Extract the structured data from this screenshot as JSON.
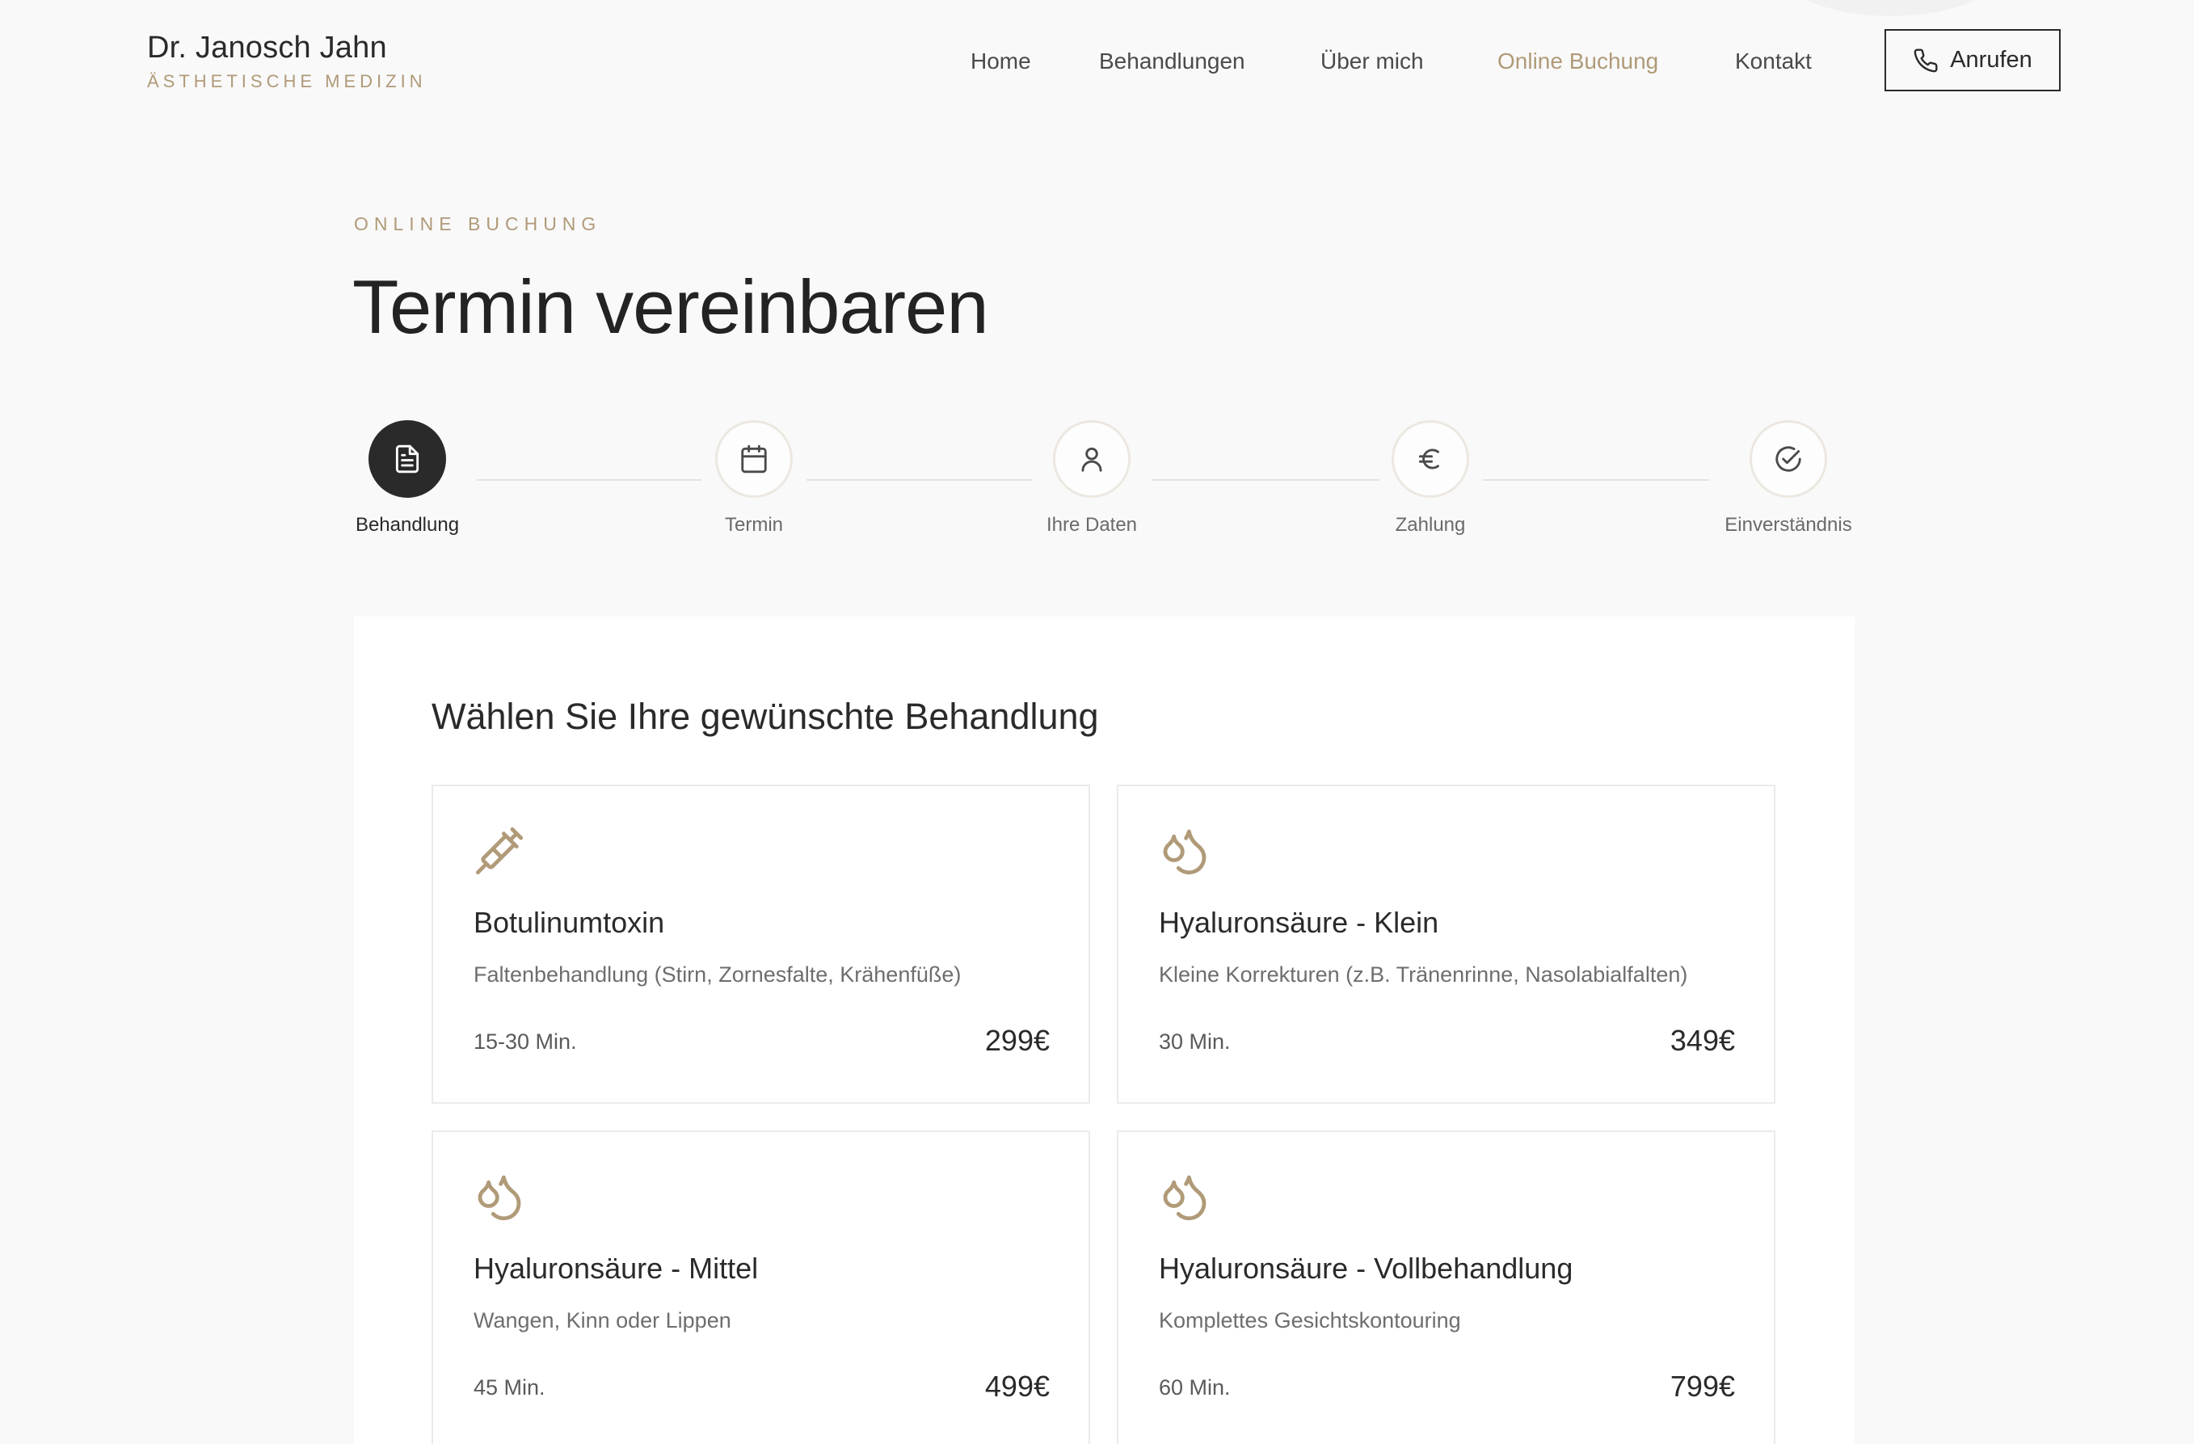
{
  "brand": {
    "name": "Dr. Janosch Jahn",
    "tagline": "ÄSTHETISCHE MEDIZIN"
  },
  "nav": {
    "items": [
      {
        "label": "Home",
        "active": false
      },
      {
        "label": "Behandlungen",
        "active": false
      },
      {
        "label": "Über mich",
        "active": false
      },
      {
        "label": "Online Buchung",
        "active": true
      },
      {
        "label": "Kontakt",
        "active": false
      }
    ],
    "call_label": "Anrufen"
  },
  "hero": {
    "eyebrow": "ONLINE BUCHUNG",
    "title": "Termin vereinbaren"
  },
  "steps": [
    {
      "label": "Behandlung",
      "icon": "document-icon",
      "active": true
    },
    {
      "label": "Termin",
      "icon": "calendar-icon",
      "active": false
    },
    {
      "label": "Ihre Daten",
      "icon": "user-icon",
      "active": false
    },
    {
      "label": "Zahlung",
      "icon": "euro-icon",
      "active": false
    },
    {
      "label": "Einverständnis",
      "icon": "check-circle-icon",
      "active": false
    }
  ],
  "treatments": {
    "heading": "Wählen Sie Ihre gewünschte Behandlung",
    "items": [
      {
        "name": "Botulinumtoxin",
        "description": "Faltenbehandlung (Stirn, Zornesfalte, Krähenfüße)",
        "duration": "15-30 Min.",
        "price": "299€",
        "icon": "syringe-icon"
      },
      {
        "name": "Hyaluronsäure - Klein",
        "description": "Kleine Korrekturen (z.B. Tränenrinne, Nasolabialfalten)",
        "duration": "30 Min.",
        "price": "349€",
        "icon": "droplets-icon"
      },
      {
        "name": "Hyaluronsäure - Mittel",
        "description": "Wangen, Kinn oder Lippen",
        "duration": "45 Min.",
        "price": "499€",
        "icon": "droplets-icon"
      },
      {
        "name": "Hyaluronsäure - Vollbehandlung",
        "description": "Komplettes Gesichtskontouring",
        "duration": "60 Min.",
        "price": "799€",
        "icon": "droplets-icon"
      }
    ]
  },
  "colors": {
    "accent": "#b09a78",
    "text": "#2a2a2a",
    "background": "#f9f9f9",
    "active_step": "#2a2a2a"
  }
}
